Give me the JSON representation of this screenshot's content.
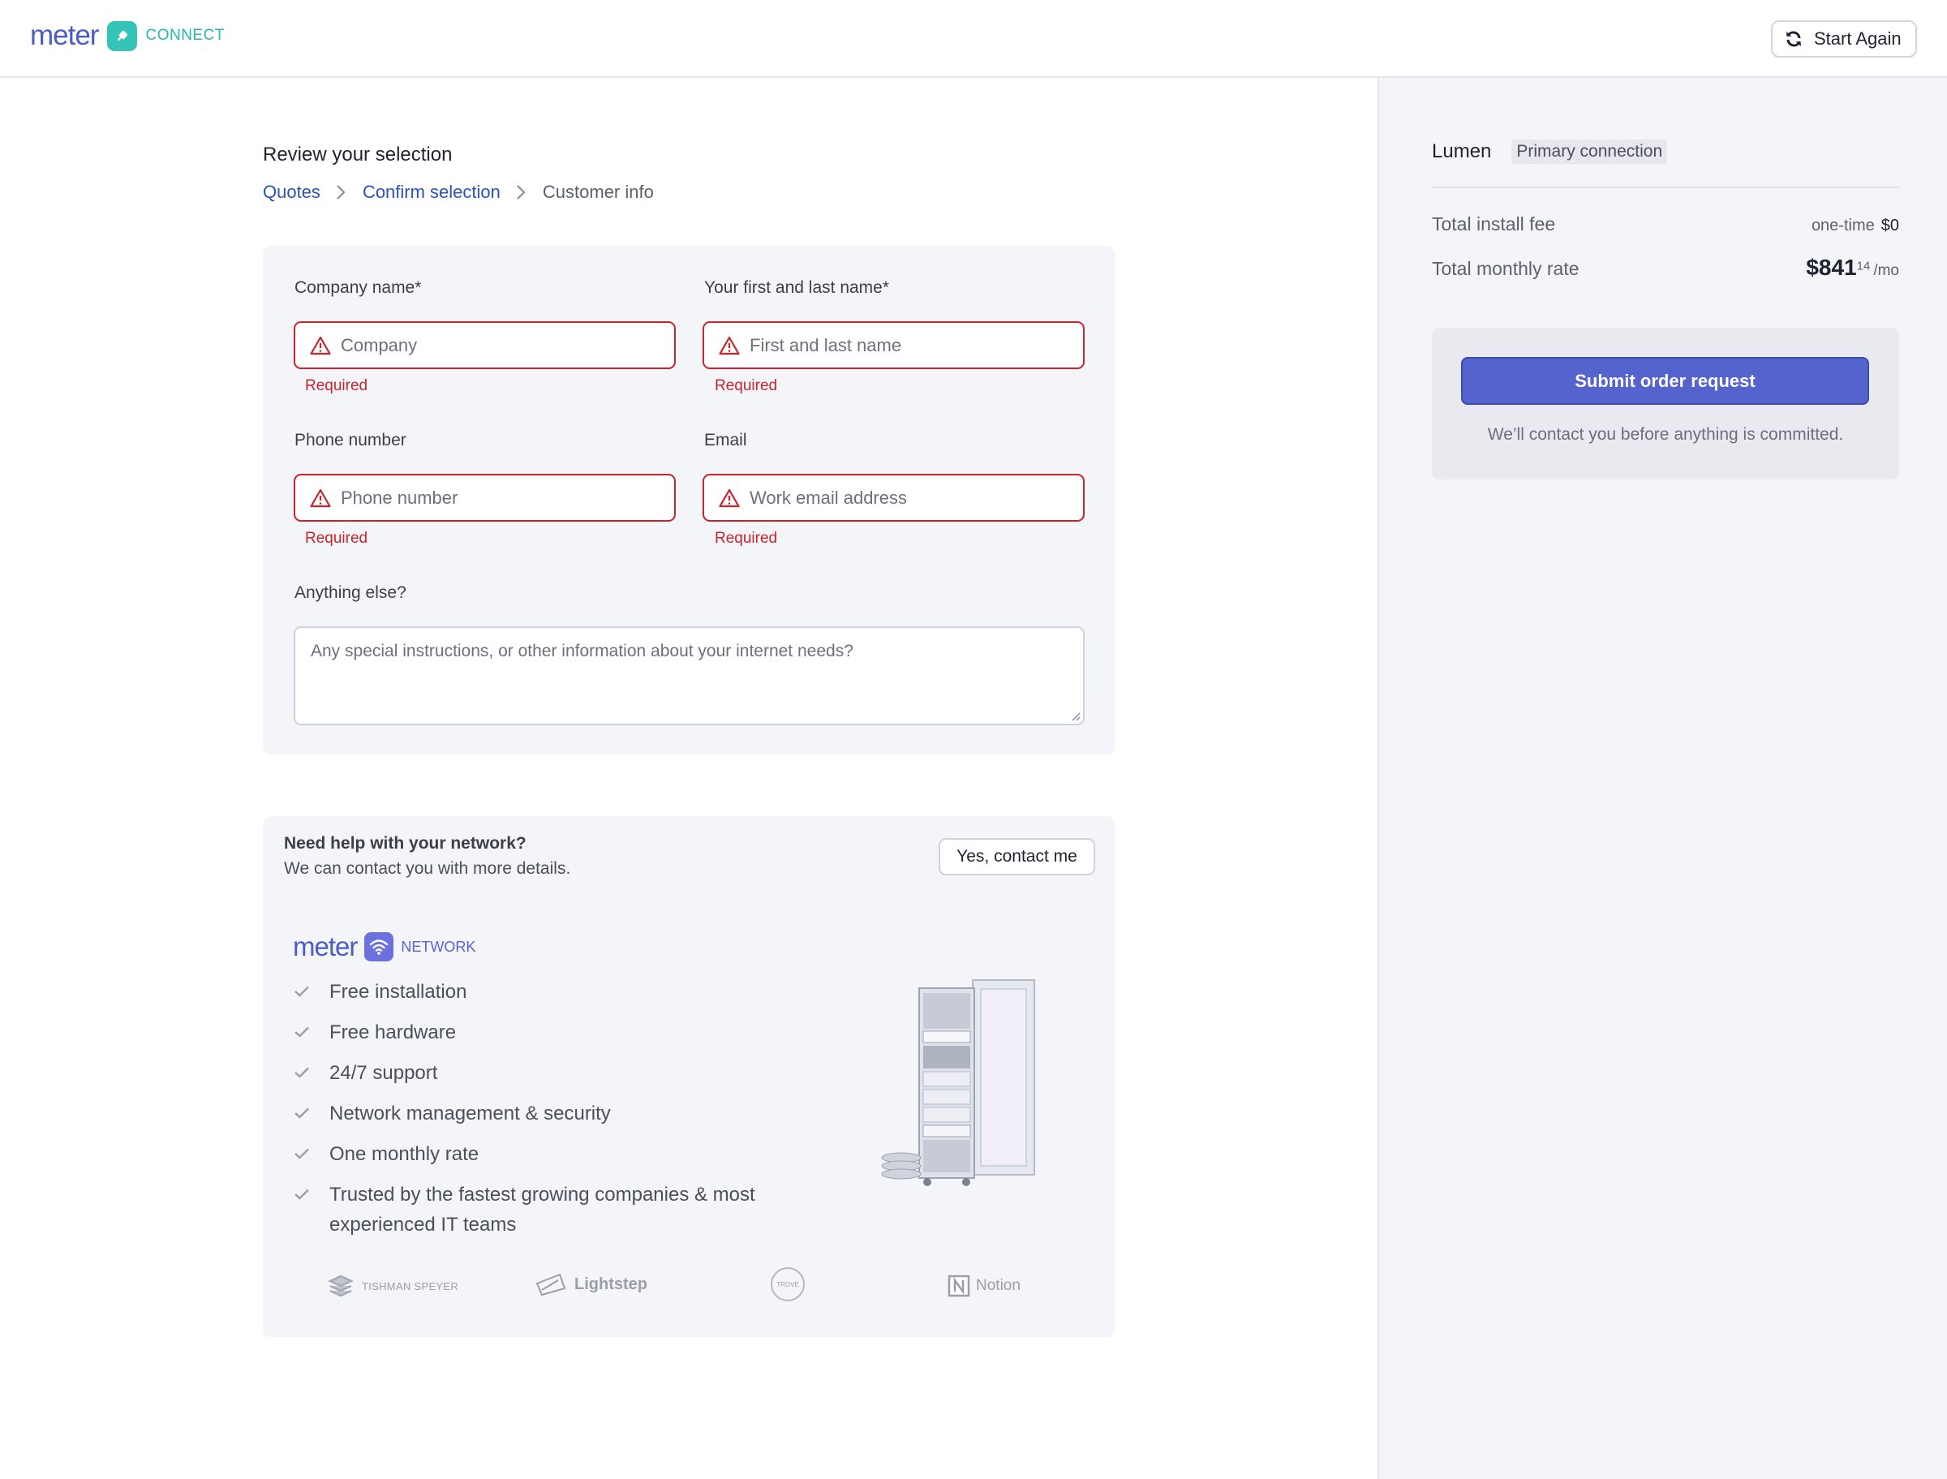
{
  "header": {
    "logo_word": "meter",
    "logo_sub": "CONNECT",
    "start_again_label": "Start Again"
  },
  "main": {
    "title": "Review your selection",
    "breadcrumbs": [
      "Quotes",
      "Confirm selection",
      "Customer info"
    ],
    "form": {
      "company_label": "Company name*",
      "company_placeholder": "Company",
      "name_label": "Your first and last name*",
      "name_placeholder": "First and last name",
      "phone_label": "Phone number",
      "phone_placeholder": "Phone number",
      "email_label": "Email",
      "email_placeholder": "Work email address",
      "error_text": "Required",
      "notes_label": "Anything else?",
      "notes_placeholder": "Any special instructions, or other information about your internet needs?"
    },
    "help": {
      "title": "Need help with your network?",
      "subtitle": "We can contact you with more details.",
      "contact_button": "Yes, contact me",
      "network_logo_word": "meter",
      "network_logo_sub": "NETWORK",
      "features": [
        "Free installation",
        "Free hardware",
        "24/7 support",
        "Network management & security",
        "One monthly rate",
        "Trusted by the fastest growing companies & most experienced IT teams"
      ],
      "customer_logos": [
        "TISHMAN SPEYER",
        "Lightstep",
        "TROVE",
        "Notion"
      ]
    }
  },
  "summary": {
    "provider": "Lumen",
    "connection_type": "Primary connection",
    "install_fee_label": "Total install fee",
    "install_fee_qualifier": "one-time",
    "install_fee_value": "$0",
    "monthly_label": "Total monthly rate",
    "monthly_dollars": "$841",
    "monthly_cents": "14",
    "monthly_unit": "/mo",
    "submit_label": "Submit order request",
    "submit_note": "We’ll contact you before anything is committed."
  },
  "colors": {
    "brand_blue": "#4b5bc7",
    "connect_teal": "#35c4b8",
    "submit_button": "#5563cf",
    "error_red": "#c9232d",
    "link_blue": "#2c52b5"
  },
  "icons": [
    "refresh-icon",
    "warning-icon",
    "chevron-right-icon",
    "check-icon",
    "wifi-icon",
    "plug-icon"
  ]
}
